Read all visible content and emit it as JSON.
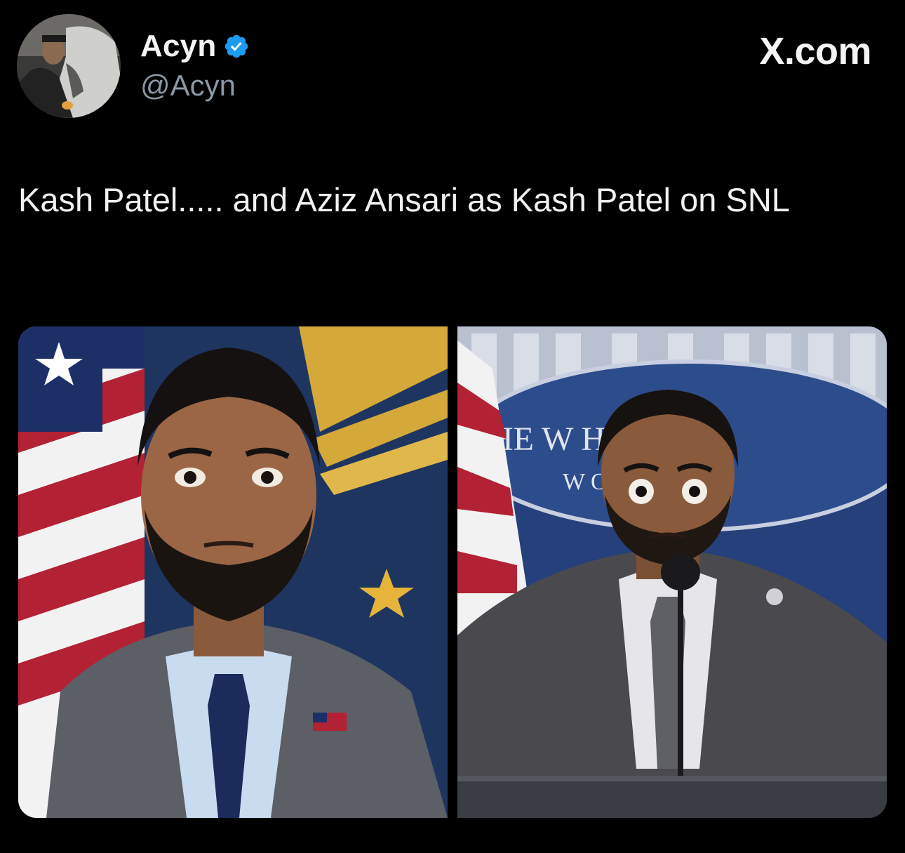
{
  "author": {
    "display_name": "Acyn",
    "handle": "@Acyn",
    "verified_icon": "verified-badge-icon",
    "verified_color": "#1d9bf0"
  },
  "brand": {
    "label": "X.com"
  },
  "tweet": {
    "text": "Kash Patel..... and Aziz Ansari as Kash Patel on SNL"
  },
  "media": {
    "left": {
      "seal_text": ""
    },
    "right": {
      "backdrop_text_1": "HE W    HOUSE",
      "backdrop_text_2": "W      ON"
    }
  },
  "colors": {
    "background": "#000000",
    "text": "#f1f1f1",
    "secondary_text": "#8b98a5"
  }
}
